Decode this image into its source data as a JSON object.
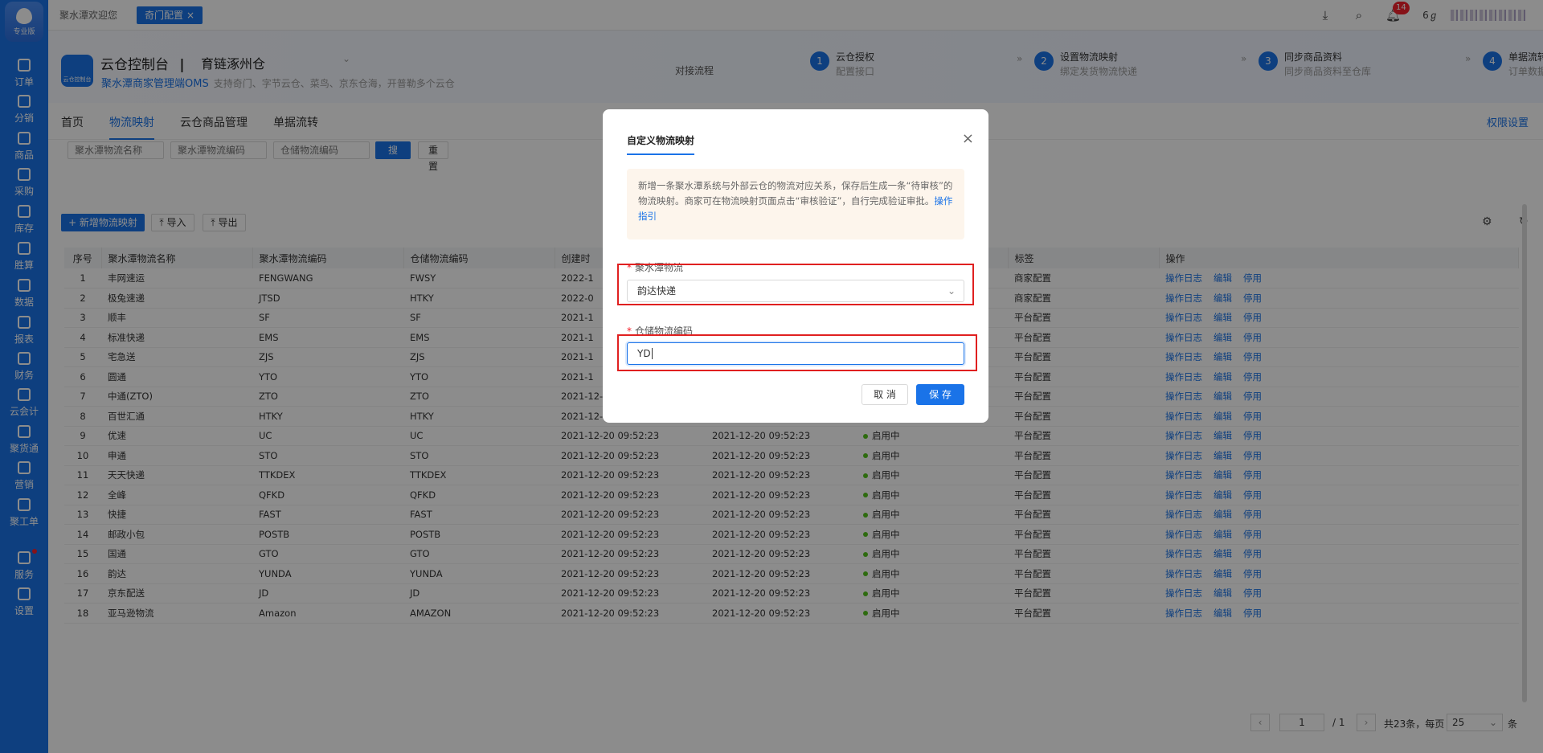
{
  "sidebar": {
    "logo_label": "专业版",
    "items": [
      {
        "label": "订单",
        "icon": "order-icon"
      },
      {
        "label": "分销",
        "icon": "distribution-icon"
      },
      {
        "label": "商品",
        "icon": "goods-icon"
      },
      {
        "label": "采购",
        "icon": "truck-icon"
      },
      {
        "label": "库存",
        "icon": "warehouse-icon"
      },
      {
        "label": "胜算",
        "icon": "calculator-icon"
      },
      {
        "label": "数据",
        "icon": "chart-icon"
      },
      {
        "label": "报表",
        "icon": "report-icon"
      },
      {
        "label": "财务",
        "icon": "finance-icon"
      },
      {
        "label": "云会计",
        "icon": "accounting-icon"
      },
      {
        "label": "聚货通",
        "icon": "circle-icon"
      },
      {
        "label": "营销",
        "icon": "mail-icon"
      },
      {
        "label": "聚工单",
        "icon": "ticket-icon"
      },
      {
        "label": "服务",
        "icon": "service-icon"
      },
      {
        "label": "设置",
        "icon": "gear-icon"
      }
    ]
  },
  "topbar": {
    "tabs": [
      {
        "label": "聚水潭欢迎您"
      },
      {
        "label": "奇门配置",
        "close": "×"
      }
    ],
    "notification_count": "14",
    "extra_label": "6ℊ"
  },
  "header": {
    "brand_logo_text": "云仓控制台",
    "console_title": "云仓控制台",
    "separator": "|",
    "org_name": "育链涿州仓",
    "oms_name": "聚水潭商家管理端OMS",
    "oms_desc": "支持奇门、字节云仓、菜鸟、京东仓海，开普勒多个云仓",
    "flow_label": "对接流程",
    "steps": [
      {
        "num": "1",
        "title": "云仓授权",
        "desc": "配置接口"
      },
      {
        "num": "2",
        "title": "设置物流映射",
        "desc": "绑定发货物流快递"
      },
      {
        "num": "3",
        "title": "同步商品资料",
        "desc": "同步商品资料至仓库"
      },
      {
        "num": "4",
        "title": "单据流转同步",
        "desc": "订单数据记录"
      }
    ]
  },
  "mainnav": {
    "items": [
      "首页",
      "物流映射",
      "云仓商品管理",
      "单据流转"
    ],
    "active": "物流映射",
    "permission": "权限设置"
  },
  "filters": {
    "name_placeholder": "聚水潭物流名称",
    "code_placeholder": "聚水潭物流编码",
    "wms_placeholder": "仓储物流编码",
    "search": "搜 索",
    "reset": "重 置"
  },
  "actions": {
    "add": "+ 新增物流映射",
    "import": "导入",
    "export": "导出"
  },
  "table": {
    "headers": [
      "序号",
      "聚水潭物流名称",
      "聚水潭物流编码",
      "仓储物流编码",
      "创建时",
      "",
      "",
      "标签",
      "操作"
    ],
    "row_actions": [
      "操作日志",
      "编辑",
      "停用"
    ],
    "rows": [
      {
        "idx": "1",
        "name": "丰网速运",
        "code": "FENGWANG",
        "wms": "FWSY",
        "created": "2022-1",
        "modified": "",
        "status": "",
        "tag": "商家配置"
      },
      {
        "idx": "2",
        "name": "极兔速递",
        "code": "JTSD",
        "wms": "HTKY",
        "created": "2022-0",
        "modified": "",
        "status": "",
        "tag": "商家配置"
      },
      {
        "idx": "3",
        "name": "顺丰",
        "code": "SF",
        "wms": "SF",
        "created": "2021-1",
        "modified": "",
        "status": "",
        "tag": "平台配置"
      },
      {
        "idx": "4",
        "name": "标准快递",
        "code": "EMS",
        "wms": "EMS",
        "created": "2021-1",
        "modified": "",
        "status": "",
        "tag": "平台配置"
      },
      {
        "idx": "5",
        "name": "宅急送",
        "code": "ZJS",
        "wms": "ZJS",
        "created": "2021-1",
        "modified": "",
        "status": "",
        "tag": "平台配置"
      },
      {
        "idx": "6",
        "name": "圆通",
        "code": "YTO",
        "wms": "YTO",
        "created": "2021-1",
        "modified": "",
        "status": "",
        "tag": "平台配置"
      },
      {
        "idx": "7",
        "name": "中通(ZTO)",
        "code": "ZTO",
        "wms": "ZTO",
        "created": "2021-12-20 09:52:23",
        "modified": "2021-12-20 09:52:23",
        "status": "启用中",
        "tag": "平台配置"
      },
      {
        "idx": "8",
        "name": "百世汇通",
        "code": "HTKY",
        "wms": "HTKY",
        "created": "2021-12-20 09:52:23",
        "modified": "2021-12-20 09:52:23",
        "status": "启用中",
        "tag": "平台配置"
      },
      {
        "idx": "9",
        "name": "优速",
        "code": "UC",
        "wms": "UC",
        "created": "2021-12-20 09:52:23",
        "modified": "2021-12-20 09:52:23",
        "status": "启用中",
        "tag": "平台配置"
      },
      {
        "idx": "10",
        "name": "申通",
        "code": "STO",
        "wms": "STO",
        "created": "2021-12-20 09:52:23",
        "modified": "2021-12-20 09:52:23",
        "status": "启用中",
        "tag": "平台配置"
      },
      {
        "idx": "11",
        "name": "天天快递",
        "code": "TTKDEX",
        "wms": "TTKDEX",
        "created": "2021-12-20 09:52:23",
        "modified": "2021-12-20 09:52:23",
        "status": "启用中",
        "tag": "平台配置"
      },
      {
        "idx": "12",
        "name": "全峰",
        "code": "QFKD",
        "wms": "QFKD",
        "created": "2021-12-20 09:52:23",
        "modified": "2021-12-20 09:52:23",
        "status": "启用中",
        "tag": "平台配置"
      },
      {
        "idx": "13",
        "name": "快捷",
        "code": "FAST",
        "wms": "FAST",
        "created": "2021-12-20 09:52:23",
        "modified": "2021-12-20 09:52:23",
        "status": "启用中",
        "tag": "平台配置"
      },
      {
        "idx": "14",
        "name": "邮政小包",
        "code": "POSTB",
        "wms": "POSTB",
        "created": "2021-12-20 09:52:23",
        "modified": "2021-12-20 09:52:23",
        "status": "启用中",
        "tag": "平台配置"
      },
      {
        "idx": "15",
        "name": "国通",
        "code": "GTO",
        "wms": "GTO",
        "created": "2021-12-20 09:52:23",
        "modified": "2021-12-20 09:52:23",
        "status": "启用中",
        "tag": "平台配置"
      },
      {
        "idx": "16",
        "name": "韵达",
        "code": "YUNDA",
        "wms": "YUNDA",
        "created": "2021-12-20 09:52:23",
        "modified": "2021-12-20 09:52:23",
        "status": "启用中",
        "tag": "平台配置"
      },
      {
        "idx": "17",
        "name": "京东配送",
        "code": "JD",
        "wms": "JD",
        "created": "2021-12-20 09:52:23",
        "modified": "2021-12-20 09:52:23",
        "status": "启用中",
        "tag": "平台配置"
      },
      {
        "idx": "18",
        "name": "亚马逊物流",
        "code": "Amazon",
        "wms": "AMAZON",
        "created": "2021-12-20 09:52:23",
        "modified": "2021-12-20 09:52:23",
        "status": "启用中",
        "tag": "平台配置"
      }
    ]
  },
  "pagination": {
    "current": "1",
    "total_pages": "/ 1",
    "summary": "共23条，每页",
    "page_size": "25",
    "unit": "条"
  },
  "modal": {
    "title": "自定义物流映射",
    "close": "×",
    "notice": "新增一条聚水潭系统与外部云仓的物流对应关系，保存后生成一条“待审核”的物流映射。商家可在物流映射页面点击“审核验证”，自行完成验证审批。",
    "guide_link": "操作指引",
    "field1_label": "聚水潭物流",
    "field1_value": "韵达快递",
    "field2_label": "仓储物流编码",
    "field2_value": "YD",
    "required_mark": "*",
    "cancel": "取 消",
    "save": "保 存"
  },
  "colors": {
    "accent": "#1a73e8",
    "highlight_box": "#e02020",
    "status_on": "#52c41a"
  }
}
